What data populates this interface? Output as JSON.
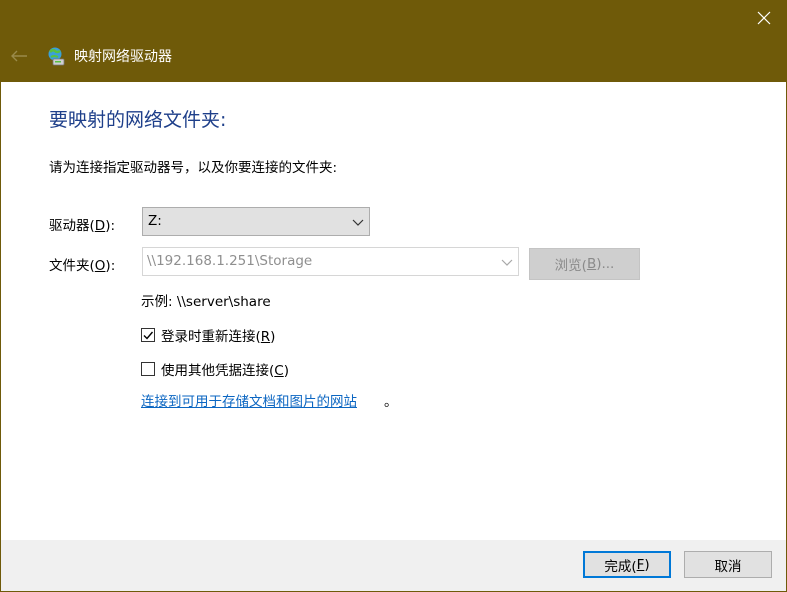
{
  "window": {
    "title": "映射网络驱动器",
    "colors": {
      "titlebar": "#6f5a09",
      "accent": "#0078d7",
      "heading": "#1e3f8a",
      "link": "#0b66c2"
    }
  },
  "main": {
    "heading": "要映射的网络文件夹:",
    "instruction": "请为连接指定驱动器号，以及你要连接的文件夹:",
    "drive": {
      "label_pre": "驱动器(",
      "label_key": "D",
      "label_post": "):",
      "value": "Z:"
    },
    "folder": {
      "label_pre": "文件夹(",
      "label_key": "O",
      "label_post": "):",
      "value": "\\\\192.168.1.251\\Storage"
    },
    "browse": {
      "pre": "浏览(",
      "key": "B",
      "post": ")..."
    },
    "example": "示例: \\\\server\\share",
    "reconnect": {
      "pre": "登录时重新连接(",
      "key": "R",
      "post": ")",
      "checked": true
    },
    "other_creds": {
      "pre": "使用其他凭据连接(",
      "key": "C",
      "post": ")",
      "checked": false
    },
    "link": "连接到可用于存储文档和图片的网站",
    "link_tail": "。"
  },
  "footer": {
    "finish": {
      "pre": "完成(",
      "key": "F",
      "post": ")"
    },
    "cancel": "取消"
  },
  "icons": {
    "close": "close-icon",
    "back": "back-arrow-icon",
    "app": "network-drive-icon",
    "dropdown": "chevron-down-icon",
    "check": "checkmark-icon"
  }
}
